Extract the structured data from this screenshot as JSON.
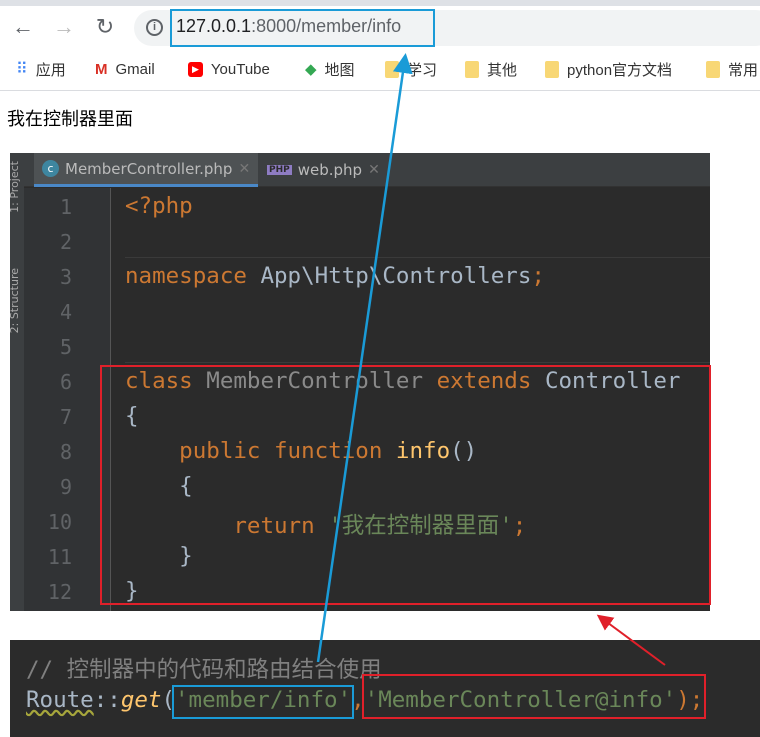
{
  "browser": {
    "url_host": "127.0.0.1",
    "url_rest": ":8000/member/info",
    "bookmarks": [
      {
        "label": "应用",
        "icon": "apps-grid-icon"
      },
      {
        "label": "Gmail",
        "icon": "gmail-icon"
      },
      {
        "label": "YouTube",
        "icon": "youtube-icon"
      },
      {
        "label": "地图",
        "icon": "maps-icon"
      },
      {
        "label": "学习",
        "icon": "folder-icon"
      },
      {
        "label": "其他",
        "icon": "folder-icon"
      },
      {
        "label": "python官方文档",
        "icon": "folder-icon"
      },
      {
        "label": "常用",
        "icon": "folder-icon"
      }
    ]
  },
  "page": {
    "body_text": "我在控制器里面"
  },
  "editor": {
    "side_labels": [
      "1: Project",
      "2: Structure"
    ],
    "tabs": [
      {
        "label": "MemberController.php",
        "icon": "c",
        "active": true
      },
      {
        "label": "web.php",
        "icon": "PHP",
        "active": false
      }
    ],
    "line_numbers": [
      "1",
      "2",
      "3",
      "4",
      "5",
      "6",
      "7",
      "8",
      "9",
      "10",
      "11",
      "12"
    ],
    "lines": {
      "l1": "<?php",
      "l3a": "namespace",
      "l3b": " App\\Http\\Controllers",
      "l3c": ";",
      "l6a": "class",
      "l6b": " MemberController",
      "l6c": " extends",
      "l6d": " Controller",
      "l7": "{",
      "l8a": "    public function",
      "l8b": " info",
      "l8c": "()",
      "l9": "    {",
      "l10a": "        return",
      "l10b": " '我在控制器里面'",
      "l10c": ";",
      "l11": "    }",
      "l12": "}"
    }
  },
  "snippet": {
    "comment": "// 控制器中的代码和路由结合使用",
    "route_a": "Route",
    "route_b": "::",
    "route_c": "get",
    "route_d": "(",
    "arg1": "'member/info'",
    "comma": ",",
    "arg2": "'MemberController@info'",
    "close": ");"
  },
  "annotation_colors": {
    "blue": "#1a9bd7",
    "red": "#e0202a"
  }
}
